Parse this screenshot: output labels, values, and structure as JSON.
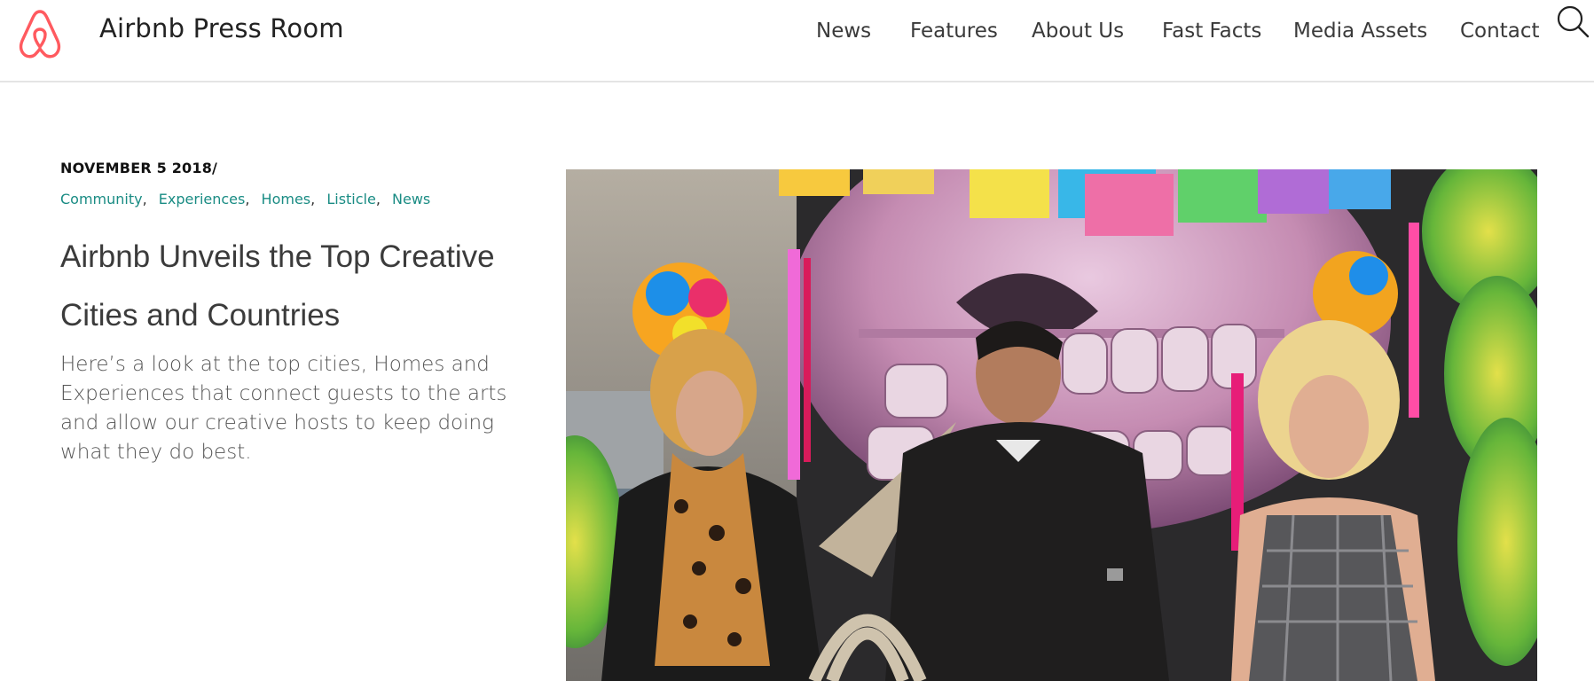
{
  "header": {
    "site_title": "Airbnb Press Room",
    "brand_color": "#ff5a5f",
    "nav": [
      {
        "label": "News"
      },
      {
        "label": "Features"
      },
      {
        "label": "About Us"
      },
      {
        "label": "Fast Facts"
      },
      {
        "label": "Media Assets"
      },
      {
        "label": "Contact"
      }
    ],
    "logo_icon": "airbnb-belo-icon",
    "search_icon": "search-icon"
  },
  "article": {
    "date": "NOVEMBER 5 2018/",
    "categories": [
      "Community",
      "Experiences",
      "Homes",
      "Listicle",
      "News"
    ],
    "category_color": "#1a8c84",
    "title": "Airbnb Unveils the Top Creative Cities and Countries",
    "summary": "Here’s a look at the top cities, Homes and Experiences that connect guests to the arts and allow our creative hosts to keep doing what they do best."
  }
}
